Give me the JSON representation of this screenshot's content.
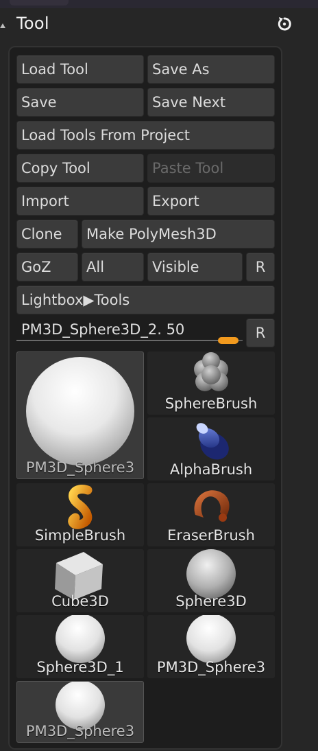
{
  "panel": {
    "title": "Tool",
    "buttons": {
      "load_tool": "Load Tool",
      "save_as": "Save As",
      "save": "Save",
      "save_next": "Save Next",
      "load_tools_from_project": "Load Tools From Project",
      "copy_tool": "Copy Tool",
      "paste_tool": "Paste Tool",
      "import": "Import",
      "export": "Export",
      "clone": "Clone",
      "make_polymesh3d": "Make PolyMesh3D",
      "goz": "GoZ",
      "all": "All",
      "visible": "Visible",
      "r_goz": "R",
      "lightbox_tools": "Lightbox▶Tools",
      "r_slider": "R"
    },
    "slider": {
      "label": "PM3D_Sphere3D_2.",
      "value": "50",
      "fraction": 0.98
    }
  },
  "tools": [
    {
      "label": "PM3D_Sphere3",
      "icon": "large-white-sphere-icon",
      "selected": true
    },
    {
      "label": "SphereBrush",
      "icon": "sphere-brush-icon"
    },
    {
      "label": "AlphaBrush",
      "icon": "alpha-brush-icon"
    },
    {
      "label": "SimpleBrush",
      "icon": "simple-brush-icon"
    },
    {
      "label": "EraserBrush",
      "icon": "eraser-brush-icon"
    },
    {
      "label": "Cube3D",
      "icon": "cube-icon"
    },
    {
      "label": "Sphere3D",
      "icon": "gray-sphere-icon"
    },
    {
      "label": "Sphere3D_1",
      "icon": "white-sphere-icon"
    },
    {
      "label": "PM3D_Sphere3",
      "icon": "white-sphere-icon"
    },
    {
      "label": "PM3D_Sphere3",
      "icon": "white-sphere-icon",
      "selected": true
    }
  ],
  "colors": {
    "accent": "#f29a1e",
    "panel_bg": "#1d1d1d",
    "button_bg": "#3b3b3b"
  }
}
